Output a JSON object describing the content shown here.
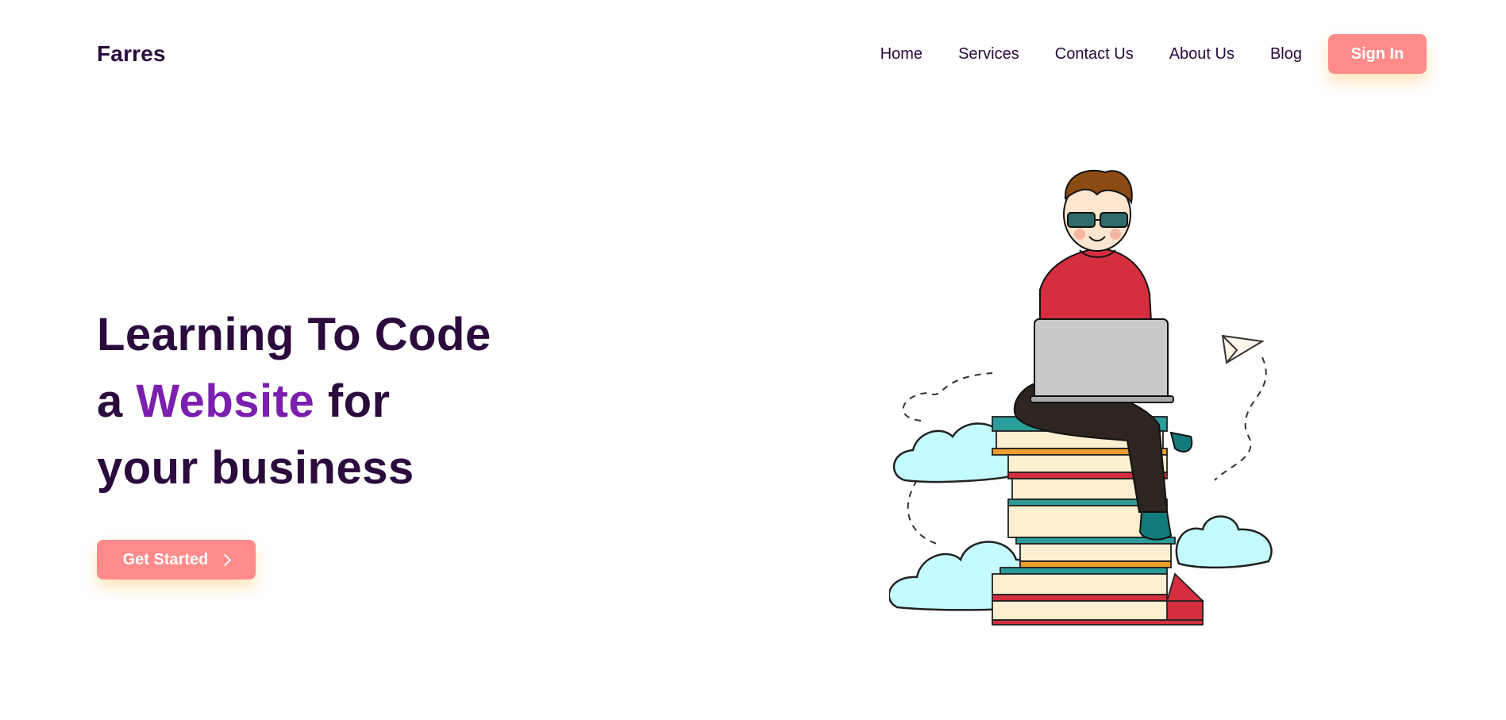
{
  "header": {
    "logo": "Farres",
    "nav": [
      "Home",
      "Services",
      "Contact Us",
      "About Us",
      "Blog"
    ],
    "signin_label": "Sign In"
  },
  "hero": {
    "line1": "Learning To Code",
    "line2_prefix": "a ",
    "line2_accent": "Website",
    "line2_suffix": " for",
    "line3": "your business",
    "cta_label": "Get Started"
  },
  "colors": {
    "primary_text": "#2b0a3d",
    "accent": "#7a1fae",
    "button": "#ff8b8b"
  },
  "icons": {
    "cta_icon": "chevron-right-icon"
  }
}
